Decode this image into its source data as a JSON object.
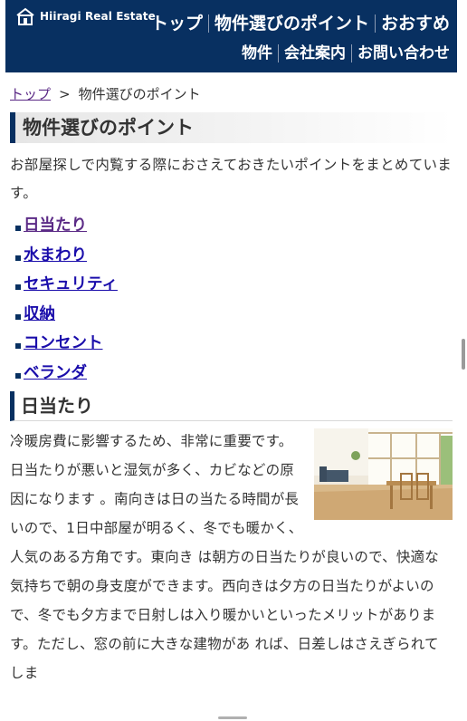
{
  "header": {
    "logo_text": "Hiiragi Real Estate",
    "logo_icon": "house-icon",
    "nav_row1": [
      "トップ",
      "物件選びのポイント",
      "おおすめ"
    ],
    "nav_row2": [
      "物件",
      "会社案内",
      "お問い合わせ"
    ],
    "background": "#083061"
  },
  "breadcrumb": {
    "home": "トップ",
    "separator": ">",
    "current": "物件選びのポイント"
  },
  "page": {
    "title": "物件選びのポイント",
    "lead": "お部屋探しで内覧する際におさえておきたいポイントをまとめています。"
  },
  "toc": [
    {
      "label": "日当たり",
      "visited": true
    },
    {
      "label": "水まわり",
      "visited": false
    },
    {
      "label": "セキュリティ",
      "visited": false
    },
    {
      "label": "収納",
      "visited": false
    },
    {
      "label": "コンセント",
      "visited": false
    },
    {
      "label": "ベランダ",
      "visited": false
    }
  ],
  "section": {
    "title": "日当たり",
    "body": "冷暖房費に影響するため、非常に重要です。日当たりが悪いと湿気が多く、カビなどの原因になります 。南向きは日の当たる時間が長いので、1日中部屋が明るく、冬でも暖かく、人気のある方角です。東向き は朝方の日当たりが良いので、快適な気持ちで朝の身支度ができます。西向きは夕方の日当たりがよいの で、冬でも夕方まで日射しは入り暖かいといったメリットがあります。ただし、窓の前に大きな建物があ れば、日差しはさえぎられてしま"
  },
  "colors": {
    "accent": "#083061",
    "visited_link": "#5b2a86",
    "link": "#1a0dab",
    "text": "#333333"
  }
}
